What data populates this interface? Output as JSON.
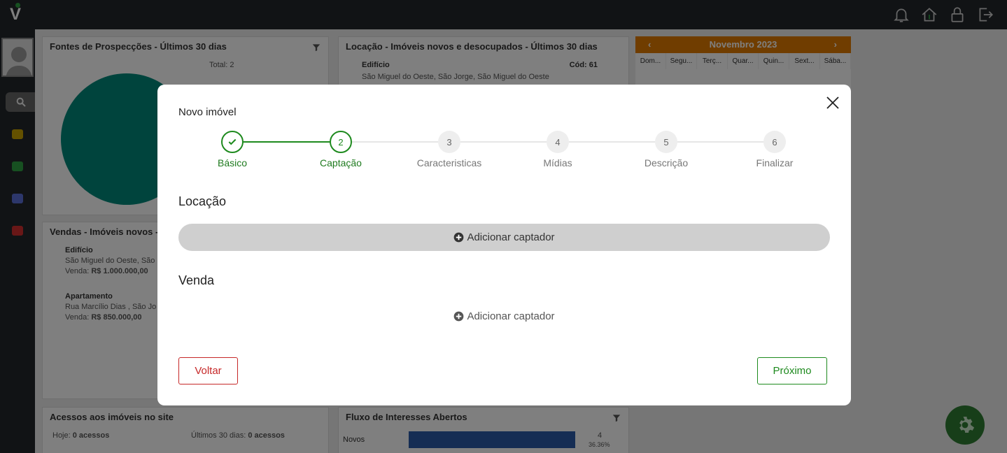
{
  "app": {
    "logo_letter": "V"
  },
  "dashboard": {
    "panel_sources_title": "Fontes de Prospecções - Últimos 30 dias",
    "panel_sources_total": "Total: 2",
    "panel_rental_title": "Locação - Imóveis novos e desocupados - Últimos 30 dias",
    "rental_item_type": "Edifício",
    "rental_item_code": "Cód: 61",
    "rental_item_address": "São Miguel do Oeste, São Jorge, São Miguel do Oeste",
    "calendar_month": "Novembro 2023",
    "calendar_days": [
      "Dom...",
      "Segu...",
      "Terç...",
      "Quar...",
      "Quin...",
      "Sext...",
      "Sába..."
    ],
    "panel_sales_title": "Vendas - Imóveis novos - U",
    "sales_items": [
      {
        "type": "Edifício",
        "address": "São Miguel do Oeste, São",
        "price_label": "Venda:",
        "price": "R$ 1.000.000,00"
      },
      {
        "type": "Apartamento",
        "address": "Rua Marcílio Dias , São Jo",
        "price_label": "Venda:",
        "price": "R$ 850.000,00"
      }
    ],
    "panel_access_title": "Acessos aos imóveis no site",
    "access_today_label": "Hoje:",
    "access_today_value": "0 acessos",
    "access_30_label": "Últimos 30 dias:",
    "access_30_value": "0 acessos",
    "panel_flow_title": "Fluxo de Interesses Abertos",
    "flow_row_label": "Novos",
    "flow_row_count": "4",
    "flow_row_pct": "36.36%",
    "flow_row_fraction": 0.95
  },
  "modal": {
    "title": "Novo imóvel",
    "steps": [
      {
        "number": "1",
        "label": "Básico",
        "state": "done"
      },
      {
        "number": "2",
        "label": "Captação",
        "state": "active"
      },
      {
        "number": "3",
        "label": "Caracteristicas",
        "state": "pending"
      },
      {
        "number": "4",
        "label": "Mídias",
        "state": "pending"
      },
      {
        "number": "5",
        "label": "Descrição",
        "state": "pending"
      },
      {
        "number": "6",
        "label": "Finalizar",
        "state": "pending"
      }
    ],
    "section_rental": "Locação",
    "section_sale": "Venda",
    "add_captador_label": "Adicionar captador",
    "back_label": "Voltar",
    "next_label": "Próximo"
  },
  "colors": {
    "accent_green": "#1e8a1e",
    "danger_red": "#c62828",
    "calendar_orange": "#e07b00",
    "topbar": "#23262b"
  }
}
